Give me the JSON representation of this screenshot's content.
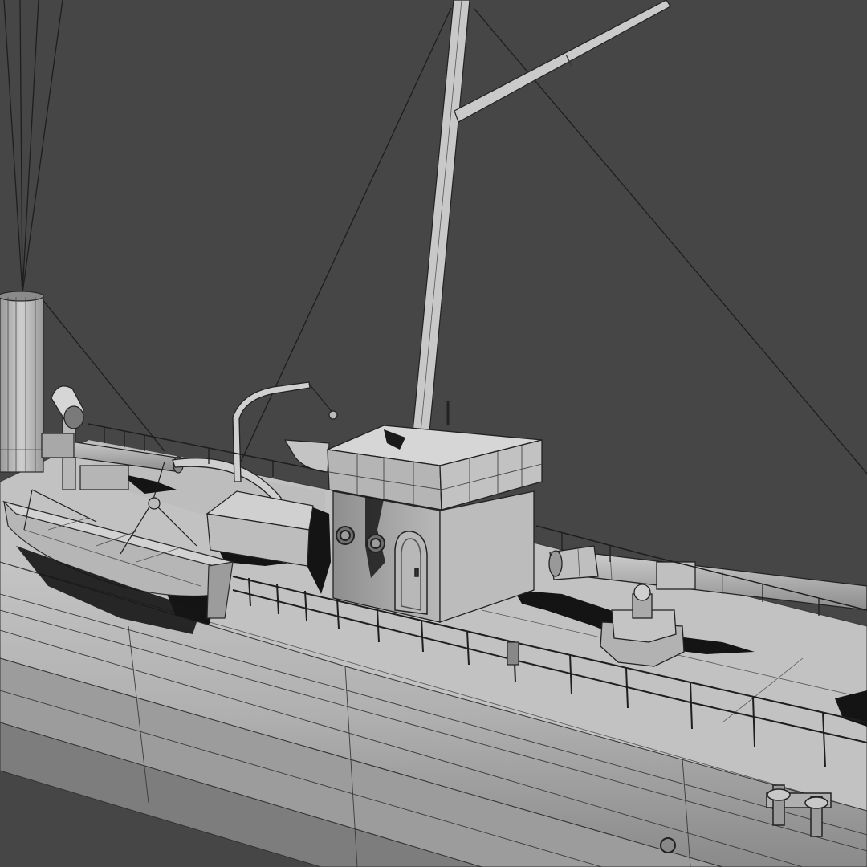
{
  "scene": {
    "subject": "ship-wireframe-model",
    "background_color": "#464646",
    "hull_color": "#b4b4b4",
    "deck_color": "#c2c2c2",
    "wire_color": "#1e1e1e",
    "shadow_color": "#141414"
  }
}
